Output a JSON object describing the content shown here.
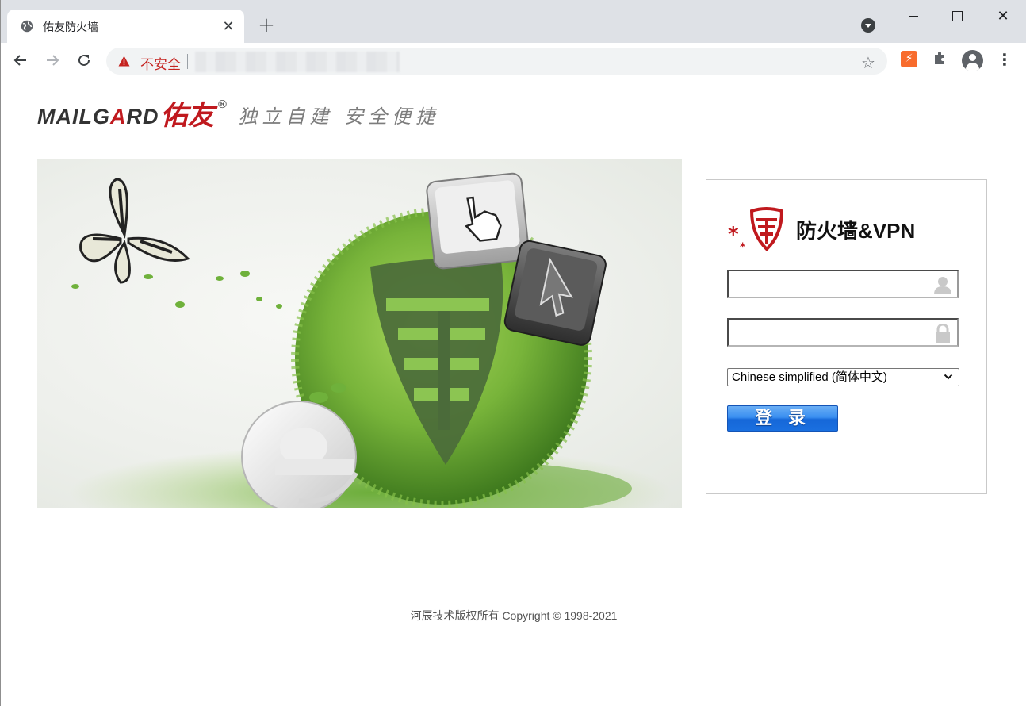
{
  "browser": {
    "tab_title": "佑友防火墙",
    "tab_close": "✕",
    "new_tab": "+",
    "security_label": "不安全",
    "window_close": "✕",
    "menu": "⋮",
    "star": "☆"
  },
  "header": {
    "brand_prefix": "MAILG",
    "brand_red": "A",
    "brand_suffix": "RD",
    "brand_cn": "佑友",
    "brand_reg": "®",
    "slogan": "独立自建 安全便捷"
  },
  "login": {
    "title": "防火墙&VPN",
    "username_value": "",
    "password_value": "",
    "language_selected": "Chinese simplified (简体中文)",
    "submit_label": "登 录"
  },
  "footer": {
    "copyright": "河辰技术版权所有 Copyright © 1998-2021"
  },
  "colors": {
    "brand_red": "#c0191e",
    "security_red": "#c5221f",
    "button_blue": "#1a70e0"
  },
  "icons": {
    "favicon": "globe-icon",
    "username_field": "user-icon",
    "password_field": "lock-icon",
    "logo": "firewall-shield-icon"
  }
}
